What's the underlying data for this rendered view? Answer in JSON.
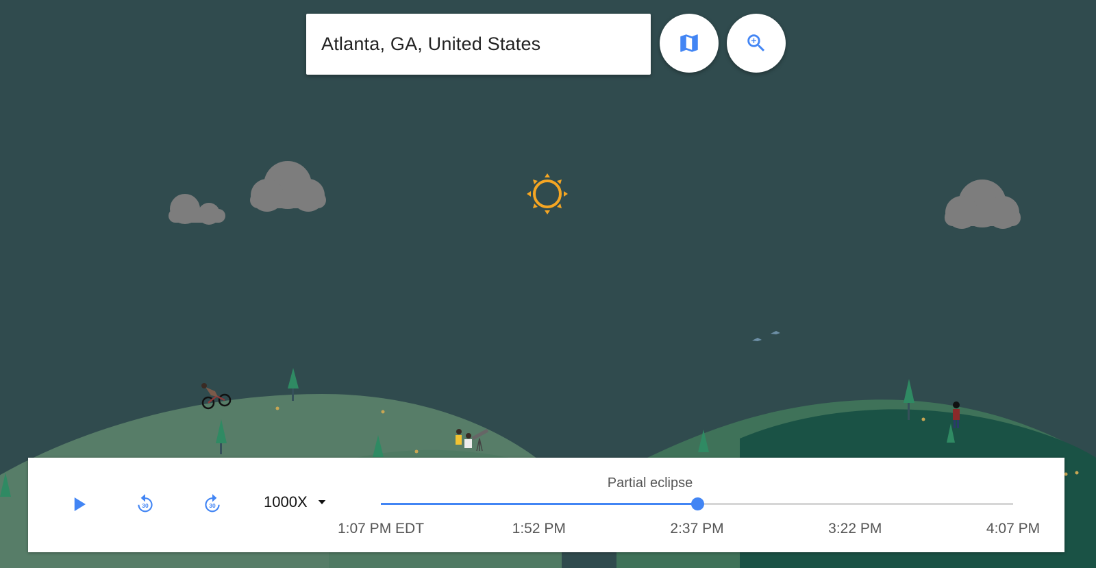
{
  "search": {
    "location": "Atlanta, GA, United States"
  },
  "top_buttons": {
    "map_icon": "map-icon",
    "zoom_icon": "zoom-in-icon"
  },
  "controls": {
    "play_icon": "play-icon",
    "rewind_icon": "replay-30-icon",
    "rewind_label": "30",
    "forward_icon": "forward-30-icon",
    "forward_label": "30",
    "speed": "1000X",
    "speed_dropdown_icon": "caret-down-icon",
    "phase": "Partial eclipse",
    "progress": 0.5,
    "ticks": [
      "1:07 PM EDT",
      "1:52 PM",
      "2:37 PM",
      "3:22 PM",
      "4:07 PM"
    ]
  },
  "colors": {
    "sky": "#304b4e",
    "accent": "#4285f4",
    "sun": "#f5a623"
  }
}
